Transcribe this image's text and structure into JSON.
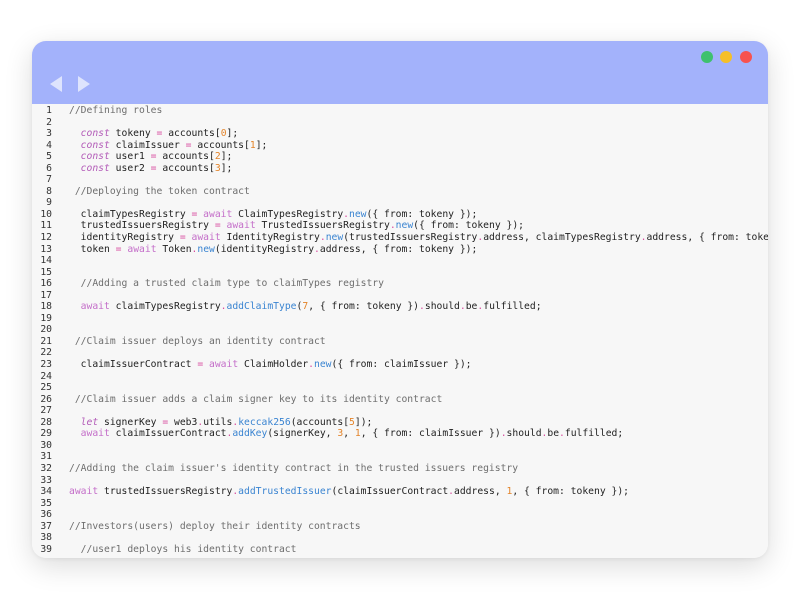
{
  "window": {
    "controls": {
      "green": "maximize",
      "yellow": "minimize",
      "red": "close"
    },
    "nav": {
      "back_icon": "arrow-left-icon",
      "forward_icon": "arrow-right-icon"
    }
  },
  "colors": {
    "titlebar": "#a3b2fb",
    "editor_bg": "#f7f7f7",
    "keyword": "#b35bb8",
    "operator": "#d94fa0",
    "number": "#e3842a",
    "function": "#3a84d1",
    "comment": "#6e6e6e"
  },
  "code": {
    "lines": [
      {
        "n": "1",
        "tokens": [
          {
            "t": "//Defining roles",
            "c": "cm"
          }
        ]
      },
      {
        "n": "2",
        "tokens": []
      },
      {
        "n": "3",
        "tokens": [
          {
            "t": "  "
          },
          {
            "t": "const",
            "c": "kw"
          },
          {
            "t": " tokeny "
          },
          {
            "t": "=",
            "c": "op"
          },
          {
            "t": " accounts["
          },
          {
            "t": "0",
            "c": "num"
          },
          {
            "t": "];"
          }
        ]
      },
      {
        "n": "4",
        "tokens": [
          {
            "t": "  "
          },
          {
            "t": "const",
            "c": "kw"
          },
          {
            "t": " claimIssuer "
          },
          {
            "t": "=",
            "c": "op"
          },
          {
            "t": " accounts["
          },
          {
            "t": "1",
            "c": "num"
          },
          {
            "t": "];"
          }
        ]
      },
      {
        "n": "5",
        "tokens": [
          {
            "t": "  "
          },
          {
            "t": "const",
            "c": "kw"
          },
          {
            "t": " user1 "
          },
          {
            "t": "=",
            "c": "op"
          },
          {
            "t": " accounts["
          },
          {
            "t": "2",
            "c": "num"
          },
          {
            "t": "];"
          }
        ]
      },
      {
        "n": "6",
        "tokens": [
          {
            "t": "  "
          },
          {
            "t": "const",
            "c": "kw"
          },
          {
            "t": " user2 "
          },
          {
            "t": "=",
            "c": "op"
          },
          {
            "t": " accounts["
          },
          {
            "t": "3",
            "c": "num"
          },
          {
            "t": "];"
          }
        ]
      },
      {
        "n": "7",
        "tokens": []
      },
      {
        "n": "8",
        "tokens": [
          {
            "t": " "
          },
          {
            "t": "//Deploying the token contract",
            "c": "cm"
          }
        ]
      },
      {
        "n": "9",
        "tokens": []
      },
      {
        "n": "10",
        "tokens": [
          {
            "t": "  claimTypesRegistry "
          },
          {
            "t": "=",
            "c": "op"
          },
          {
            "t": " "
          },
          {
            "t": "await",
            "c": "aw"
          },
          {
            "t": " ClaimTypesRegistry"
          },
          {
            "t": ".",
            "c": "op"
          },
          {
            "t": "new",
            "c": "fn"
          },
          {
            "t": "({ from: tokeny });"
          }
        ]
      },
      {
        "n": "11",
        "tokens": [
          {
            "t": "  trustedIssuersRegistry "
          },
          {
            "t": "=",
            "c": "op"
          },
          {
            "t": " "
          },
          {
            "t": "await",
            "c": "aw"
          },
          {
            "t": " TrustedIssuersRegistry"
          },
          {
            "t": ".",
            "c": "op"
          },
          {
            "t": "new",
            "c": "fn"
          },
          {
            "t": "({ from: tokeny });"
          }
        ]
      },
      {
        "n": "12",
        "tokens": [
          {
            "t": "  identityRegistry "
          },
          {
            "t": "=",
            "c": "op"
          },
          {
            "t": " "
          },
          {
            "t": "await",
            "c": "aw"
          },
          {
            "t": " IdentityRegistry"
          },
          {
            "t": ".",
            "c": "op"
          },
          {
            "t": "new",
            "c": "fn"
          },
          {
            "t": "(trustedIssuersRegistry"
          },
          {
            "t": ".",
            "c": "op"
          },
          {
            "t": "address, claimTypesRegistry"
          },
          {
            "t": ".",
            "c": "op"
          },
          {
            "t": "address, { from: tokeny });"
          }
        ]
      },
      {
        "n": "13",
        "tokens": [
          {
            "t": "  token "
          },
          {
            "t": "=",
            "c": "op"
          },
          {
            "t": " "
          },
          {
            "t": "await",
            "c": "aw"
          },
          {
            "t": " Token"
          },
          {
            "t": ".",
            "c": "op"
          },
          {
            "t": "new",
            "c": "fn"
          },
          {
            "t": "(identityRegistry"
          },
          {
            "t": ".",
            "c": "op"
          },
          {
            "t": "address, { from: tokeny });"
          }
        ]
      },
      {
        "n": "14",
        "tokens": []
      },
      {
        "n": "15",
        "tokens": []
      },
      {
        "n": "16",
        "tokens": [
          {
            "t": "  "
          },
          {
            "t": "//Adding a trusted claim type to claimTypes registry",
            "c": "cm"
          }
        ]
      },
      {
        "n": "17",
        "tokens": []
      },
      {
        "n": "18",
        "tokens": [
          {
            "t": "  "
          },
          {
            "t": "await",
            "c": "aw"
          },
          {
            "t": " claimTypesRegistry"
          },
          {
            "t": ".",
            "c": "op"
          },
          {
            "t": "addClaimType",
            "c": "fn"
          },
          {
            "t": "("
          },
          {
            "t": "7",
            "c": "num"
          },
          {
            "t": ", { from: tokeny })"
          },
          {
            "t": ".",
            "c": "op"
          },
          {
            "t": "should"
          },
          {
            "t": ".",
            "c": "op"
          },
          {
            "t": "be"
          },
          {
            "t": ".",
            "c": "op"
          },
          {
            "t": "fulfilled;"
          }
        ]
      },
      {
        "n": "19",
        "tokens": []
      },
      {
        "n": "20",
        "tokens": []
      },
      {
        "n": "21",
        "tokens": [
          {
            "t": " "
          },
          {
            "t": "//Claim issuer deploys an identity contract",
            "c": "cm"
          }
        ]
      },
      {
        "n": "22",
        "tokens": []
      },
      {
        "n": "23",
        "tokens": [
          {
            "t": "  claimIssuerContract "
          },
          {
            "t": "=",
            "c": "op"
          },
          {
            "t": " "
          },
          {
            "t": "await",
            "c": "aw"
          },
          {
            "t": " ClaimHolder"
          },
          {
            "t": ".",
            "c": "op"
          },
          {
            "t": "new",
            "c": "fn"
          },
          {
            "t": "({ from: claimIssuer });"
          }
        ]
      },
      {
        "n": "24",
        "tokens": []
      },
      {
        "n": "25",
        "tokens": []
      },
      {
        "n": "26",
        "tokens": [
          {
            "t": " "
          },
          {
            "t": "//Claim issuer adds a claim signer key to its identity contract",
            "c": "cm"
          }
        ]
      },
      {
        "n": "27",
        "tokens": []
      },
      {
        "n": "28",
        "tokens": [
          {
            "t": "  "
          },
          {
            "t": "let",
            "c": "kw"
          },
          {
            "t": " signerKey "
          },
          {
            "t": "=",
            "c": "op"
          },
          {
            "t": " web3"
          },
          {
            "t": ".",
            "c": "op"
          },
          {
            "t": "utils"
          },
          {
            "t": ".",
            "c": "op"
          },
          {
            "t": "keccak256",
            "c": "fn"
          },
          {
            "t": "(accounts["
          },
          {
            "t": "5",
            "c": "num"
          },
          {
            "t": "]);"
          }
        ]
      },
      {
        "n": "29",
        "tokens": [
          {
            "t": "  "
          },
          {
            "t": "await",
            "c": "aw"
          },
          {
            "t": " claimIssuerContract"
          },
          {
            "t": ".",
            "c": "op"
          },
          {
            "t": "addKey",
            "c": "fn"
          },
          {
            "t": "(signerKey, "
          },
          {
            "t": "3",
            "c": "num"
          },
          {
            "t": ", "
          },
          {
            "t": "1",
            "c": "num"
          },
          {
            "t": ", { from: claimIssuer })"
          },
          {
            "t": ".",
            "c": "op"
          },
          {
            "t": "should"
          },
          {
            "t": ".",
            "c": "op"
          },
          {
            "t": "be"
          },
          {
            "t": ".",
            "c": "op"
          },
          {
            "t": "fulfilled;"
          }
        ]
      },
      {
        "n": "30",
        "tokens": []
      },
      {
        "n": "31",
        "tokens": []
      },
      {
        "n": "32",
        "tokens": [
          {
            "t": "//Adding the claim issuer's identity contract in the trusted issuers registry",
            "c": "cm"
          }
        ]
      },
      {
        "n": "33",
        "tokens": []
      },
      {
        "n": "34",
        "tokens": [
          {
            "t": "await",
            "c": "aw"
          },
          {
            "t": " trustedIssuersRegistry"
          },
          {
            "t": ".",
            "c": "op"
          },
          {
            "t": "addTrustedIssuer",
            "c": "fn"
          },
          {
            "t": "(claimIssuerContract"
          },
          {
            "t": ".",
            "c": "op"
          },
          {
            "t": "address, "
          },
          {
            "t": "1",
            "c": "num"
          },
          {
            "t": ", { from: tokeny });"
          }
        ]
      },
      {
        "n": "35",
        "tokens": []
      },
      {
        "n": "36",
        "tokens": []
      },
      {
        "n": "37",
        "tokens": [
          {
            "t": "//Investors(users) deploy their identity contracts",
            "c": "cm"
          }
        ]
      },
      {
        "n": "38",
        "tokens": []
      },
      {
        "n": "39",
        "tokens": [
          {
            "t": "  "
          },
          {
            "t": "//user1 deploys his identity contract",
            "c": "cm"
          }
        ]
      }
    ]
  }
}
